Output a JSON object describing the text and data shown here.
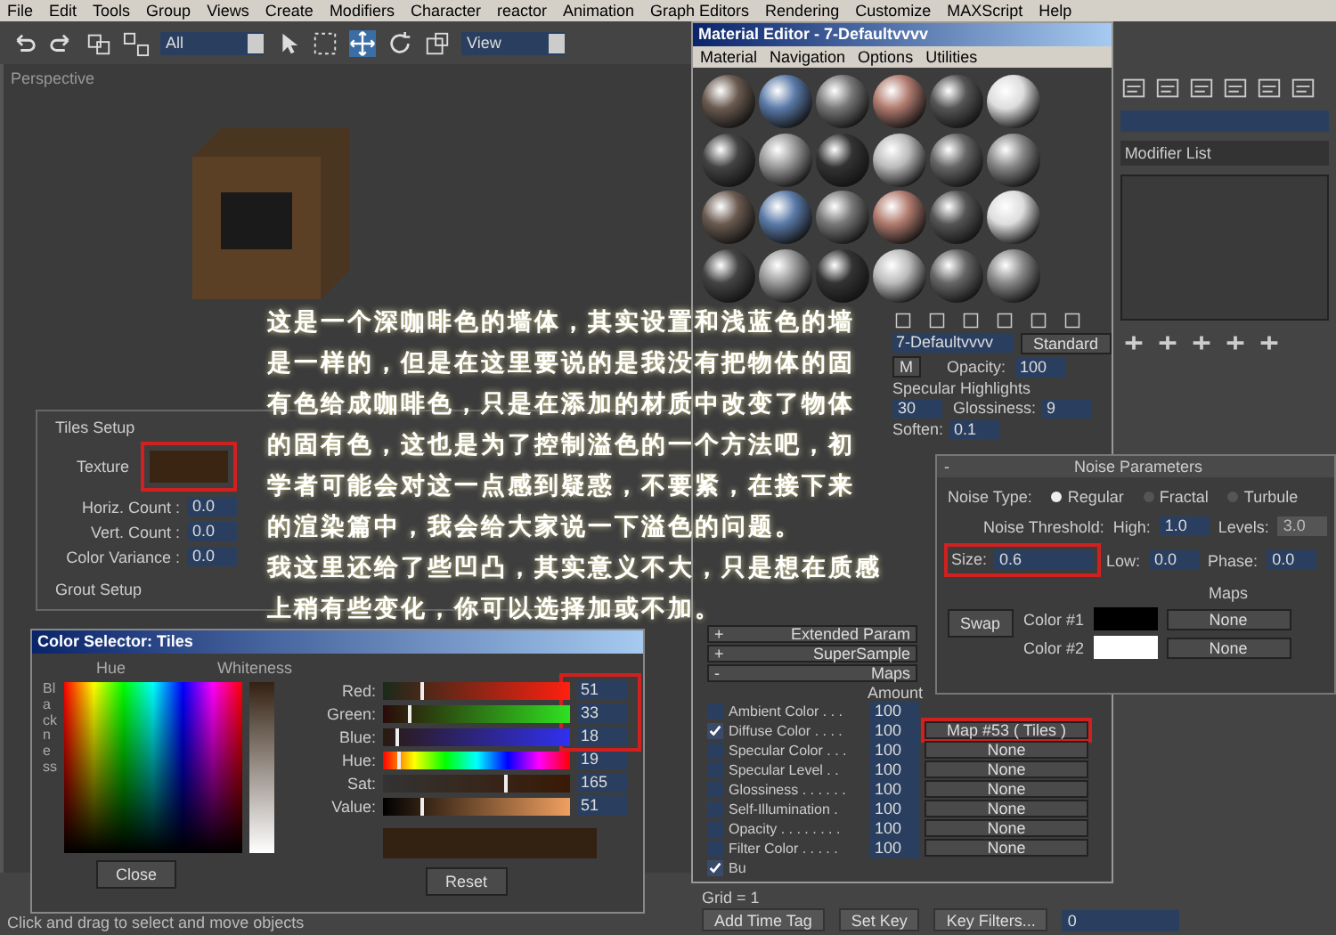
{
  "menu_bar": [
    "File",
    "Edit",
    "Tools",
    "Group",
    "Views",
    "Create",
    "Modifiers",
    "Character",
    "reactor",
    "Animation",
    "Graph Editors",
    "Rendering",
    "Customize",
    "MAXScript",
    "Help"
  ],
  "toolbar": {
    "selection_filter": "All",
    "reference_coord": "View"
  },
  "viewport": {
    "label": "Perspective"
  },
  "tiles_panel": {
    "tiles_setup": "Tiles Setup",
    "texture_label": "Texture",
    "highlighted": true,
    "fields": [
      {
        "label": "Horiz. Count :",
        "value": "0.0"
      },
      {
        "label": "Vert. Count :",
        "value": "0.0"
      },
      {
        "label": "Color Variance :",
        "value": "0.0"
      }
    ],
    "grout_setup": "Grout Setup"
  },
  "color_selector": {
    "title": "Color Selector: Tiles",
    "hue_label": "Hue",
    "whiteness_label": "Whiteness",
    "blackness_label": "Blackness",
    "rgb_highlighted": true,
    "channels": [
      {
        "kind": "red",
        "label": "Red:",
        "value": "51",
        "level": 0.2
      },
      {
        "kind": "green",
        "label": "Green:",
        "value": "33",
        "level": 0.13
      },
      {
        "kind": "blue",
        "label": "Blue:",
        "value": "18",
        "level": 0.07
      },
      {
        "kind": "hue",
        "label": "Hue:",
        "value": "19",
        "level": 0.075
      },
      {
        "kind": "sat",
        "label": "Sat:",
        "value": "165",
        "level": 0.65
      },
      {
        "kind": "value",
        "label": "Value:",
        "value": "51",
        "level": 0.2
      }
    ],
    "close": "Close",
    "reset": "Reset"
  },
  "material_editor": {
    "title": "Material Editor - 7-Defaultvvvv",
    "menus": [
      "Material",
      "Navigation",
      "Options",
      "Utilities"
    ],
    "material_name": "7-Defaultvvvv",
    "material_type": "Standard",
    "m_button": "M",
    "opacity_label": "Opacity:",
    "opacity": "100",
    "highlights_title": "Specular Highlights",
    "highlights": [
      {
        "value": "30"
      },
      {
        "label": "Glossiness:",
        "value": "9"
      },
      {
        "label": "Soften:",
        "value": "0.1"
      }
    ],
    "rollouts": [
      {
        "sign": "+",
        "label": "Extended Param"
      },
      {
        "sign": "+",
        "label": "SuperSample"
      },
      {
        "sign": "-",
        "label": "Maps"
      }
    ],
    "amount_header": "Amount",
    "maps": [
      {
        "label": "Ambient Color . . .",
        "checked": false,
        "amount": "100"
      },
      {
        "label": "Diffuse Color . . . .",
        "checked": true,
        "amount": "100",
        "map": "Map #53  ( Tiles )",
        "highlighted": true
      },
      {
        "label": "Specular Color . . .",
        "checked": false,
        "amount": "100",
        "map": "None",
        "highlighted": false
      },
      {
        "label": "Specular Level . .",
        "checked": false,
        "amount": "100",
        "map": "None",
        "highlighted": false
      },
      {
        "label": "Glossiness . . . . . .",
        "checked": false,
        "amount": "100",
        "map": "None",
        "highlighted": false
      },
      {
        "label": "Self-Illumination .",
        "checked": false,
        "amount": "100",
        "map": "None",
        "highlighted": false
      },
      {
        "label": "Opacity . . . . . . . .",
        "checked": false,
        "amount": "100",
        "map": "None",
        "highlighted": false
      },
      {
        "label": "Filter Color . . . . .",
        "checked": false,
        "amount": "100",
        "map": "None",
        "highlighted": false
      },
      {
        "label": "Bu",
        "checked": true
      }
    ]
  },
  "noise_panel": {
    "collapse": "-",
    "title": "Noise Parameters",
    "noise_type_label": "Noise Type:",
    "types": [
      {
        "label": "Regular",
        "selected": true
      },
      {
        "label": "Fractal",
        "selected": false
      },
      {
        "label": "Turbule",
        "selected": false
      }
    ],
    "threshold_label": "Noise Threshold:",
    "high": {
      "label": "High:",
      "value": "1.0"
    },
    "levels": {
      "label": "Levels:",
      "value": "3.0",
      "disabled": true
    },
    "size": {
      "label": "Size:",
      "value": "0.6",
      "highlighted": true
    },
    "low": {
      "label": "Low:",
      "value": "0.0"
    },
    "phase": {
      "label": "Phase:",
      "value": "0.0"
    },
    "maps_label": "Maps",
    "swap": "Swap",
    "colors": [
      {
        "label": "Color #1",
        "color": "#000000",
        "map": "None"
      },
      {
        "label": "Color #2",
        "color": "#ffffff",
        "map": "None"
      }
    ]
  },
  "command_panel": {
    "modifier_list": "Modifier List"
  },
  "caption_lines": [
    "这是一个深咖啡色的墙体，其实设置和浅蓝色的墙",
    "是一样的，但是在这里要说的是我没有把物体的固",
    "有色给成咖啡色，只是在添加的材质中改变了物体",
    "的固有色，这也是为了控制溢色的一个方法吧，初",
    "学者可能会对这一点感到疑惑，不要紧，在接下来",
    "的渲染篇中，我会给大家说一下溢色的问题。",
    "我这里还给了些凹凸，其实意义不大，只是想在质感",
    "上稍有些变化，你可以选择加或不加。"
  ],
  "bottom": {
    "grid": "Grid = 1",
    "add_time_tag": "Add Time Tag",
    "set_key": "Set Key",
    "key_filters": "Key Filters...",
    "frame": "0",
    "status": "Click and drag to select and move objects"
  }
}
